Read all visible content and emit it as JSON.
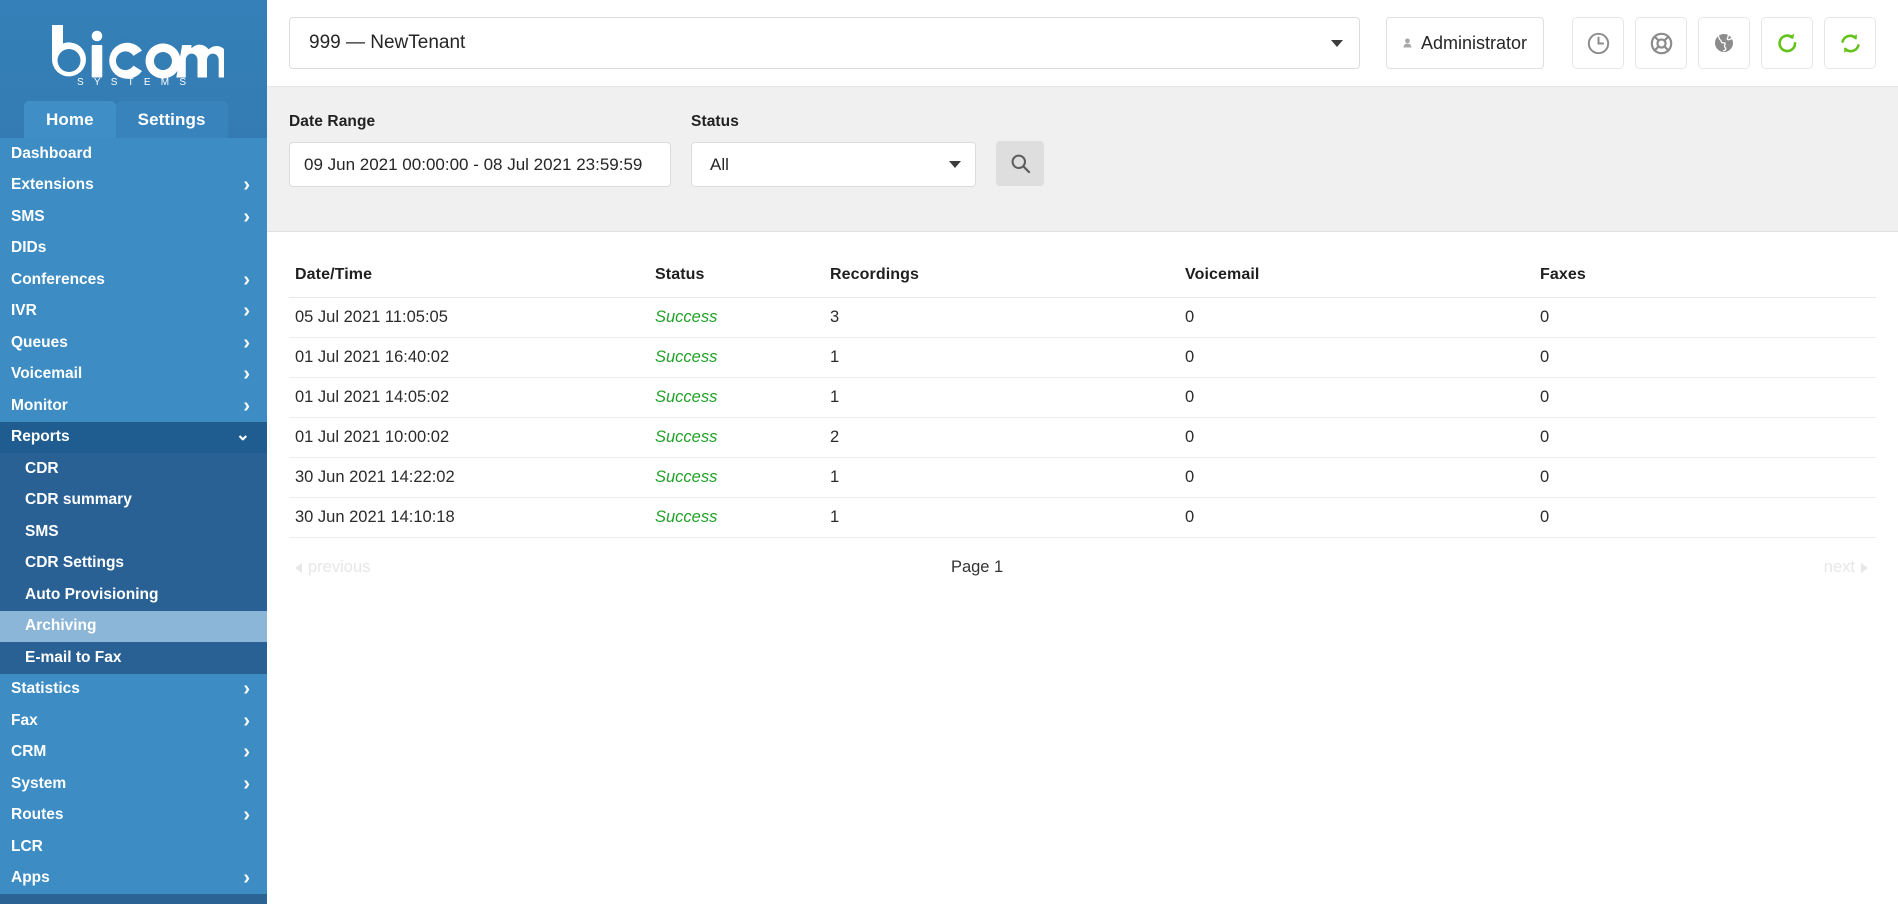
{
  "brand": {
    "name": "bicom",
    "tagline": "S Y S T E M S"
  },
  "sidebar": {
    "tabs": [
      {
        "label": "Home",
        "active": true
      },
      {
        "label": "Settings",
        "active": false
      }
    ],
    "items": [
      {
        "label": "Dashboard",
        "expandable": false,
        "level": 0
      },
      {
        "label": "Extensions",
        "expandable": true,
        "level": 0
      },
      {
        "label": "SMS",
        "expandable": true,
        "level": 0
      },
      {
        "label": "DIDs",
        "expandable": false,
        "level": 0
      },
      {
        "label": "Conferences",
        "expandable": true,
        "level": 0
      },
      {
        "label": "IVR",
        "expandable": true,
        "level": 0
      },
      {
        "label": "Queues",
        "expandable": true,
        "level": 0
      },
      {
        "label": "Voicemail",
        "expandable": true,
        "level": 0
      },
      {
        "label": "Monitor",
        "expandable": true,
        "level": 0
      },
      {
        "label": "Reports",
        "expandable": true,
        "level": 0,
        "open": true
      },
      {
        "label": "CDR",
        "expandable": false,
        "level": 1
      },
      {
        "label": "CDR summary",
        "expandable": false,
        "level": 1
      },
      {
        "label": "SMS",
        "expandable": false,
        "level": 1
      },
      {
        "label": "CDR Settings",
        "expandable": false,
        "level": 1
      },
      {
        "label": "Auto Provisioning",
        "expandable": false,
        "level": 1
      },
      {
        "label": "Archiving",
        "expandable": false,
        "level": 1,
        "selected": true
      },
      {
        "label": "E-mail to Fax",
        "expandable": false,
        "level": 1
      },
      {
        "label": "Statistics",
        "expandable": true,
        "level": 0
      },
      {
        "label": "Fax",
        "expandable": true,
        "level": 0
      },
      {
        "label": "CRM",
        "expandable": true,
        "level": 0
      },
      {
        "label": "System",
        "expandable": true,
        "level": 0
      },
      {
        "label": "Routes",
        "expandable": true,
        "level": 0
      },
      {
        "label": "LCR",
        "expandable": false,
        "level": 0
      },
      {
        "label": "Apps",
        "expandable": true,
        "level": 0
      }
    ]
  },
  "topbar": {
    "tenant_value": "999  —  NewTenant",
    "user_label": "Administrator",
    "icons": [
      {
        "name": "clock-icon",
        "color": "#8c8c8c"
      },
      {
        "name": "lifebuoy-icon",
        "color": "#8c8c8c"
      },
      {
        "name": "globe-icon",
        "color": "#8c8c8c"
      },
      {
        "name": "reload-icon",
        "color": "#63c31a"
      },
      {
        "name": "sync-icon",
        "color": "#63c31a"
      }
    ]
  },
  "filters": {
    "date_range_label": "Date Range",
    "date_range_value": "09 Jun 2021 00:00:00 - 08 Jul 2021 23:59:59",
    "status_label": "Status",
    "status_value": "All",
    "status_options": [
      "All"
    ],
    "search_icon": "search-icon"
  },
  "table": {
    "columns": [
      "Date/Time",
      "Status",
      "Recordings",
      "Voicemail",
      "Faxes"
    ],
    "rows": [
      {
        "datetime": "05 Jul 2021 11:05:05",
        "status": "Success",
        "recordings": "3",
        "voicemail": "0",
        "faxes": "0"
      },
      {
        "datetime": "01 Jul 2021 16:40:02",
        "status": "Success",
        "recordings": "1",
        "voicemail": "0",
        "faxes": "0"
      },
      {
        "datetime": "01 Jul 2021 14:05:02",
        "status": "Success",
        "recordings": "1",
        "voicemail": "0",
        "faxes": "0"
      },
      {
        "datetime": "01 Jul 2021 10:00:02",
        "status": "Success",
        "recordings": "2",
        "voicemail": "0",
        "faxes": "0"
      },
      {
        "datetime": "30 Jun 2021 14:22:02",
        "status": "Success",
        "recordings": "1",
        "voicemail": "0",
        "faxes": "0"
      },
      {
        "datetime": "30 Jun 2021 14:10:18",
        "status": "Success",
        "recordings": "1",
        "voicemail": "0",
        "faxes": "0"
      }
    ]
  },
  "pagination": {
    "previous_label": "previous",
    "page_label": "Page 1",
    "next_label": "next"
  },
  "colors": {
    "sidebar_top": "#3580b8",
    "sidebar_bottom": "#2a6394",
    "sidebar_open": "#1f5c8f",
    "sidebar_sub": "#2a6194",
    "sidebar_selected": "#8bb6d8",
    "success_green": "#22a12a",
    "icon_green": "#63c31a",
    "filter_bg": "#f0f0f0"
  }
}
